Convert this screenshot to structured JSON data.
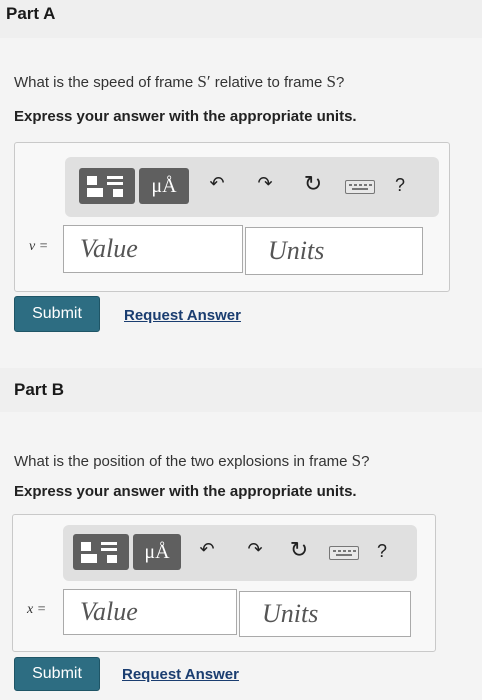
{
  "partA": {
    "header": "Part A",
    "question_before": "What is the speed of frame ",
    "question_sym1": "S′",
    "question_mid": " relative to frame ",
    "question_sym2": "S",
    "question_after": "?",
    "instruction": "Express your answer with the appropriate units.",
    "variable_label": "v =",
    "value_placeholder": "Value",
    "units_placeholder": "Units",
    "submit_label": "Submit",
    "request_label": "Request Answer"
  },
  "partB": {
    "header": "Part B",
    "question_before": "What is the position of the two explosions in frame ",
    "question_sym": "S",
    "question_after": "?",
    "instruction": "Express your answer with the appropriate units.",
    "variable_label": "x =",
    "value_placeholder": "Value",
    "units_placeholder": "Units",
    "submit_label": "Submit",
    "request_label": "Request Answer"
  },
  "toolbar": {
    "symbols_label": "μÅ",
    "undo_glyph": "↶",
    "redo_glyph": "↷",
    "reset_glyph": "↻",
    "help_label": "?",
    "icons": [
      "templates-icon",
      "symbols-icon",
      "undo-icon",
      "redo-icon",
      "reset-icon",
      "keyboard-icon",
      "help-icon"
    ]
  }
}
